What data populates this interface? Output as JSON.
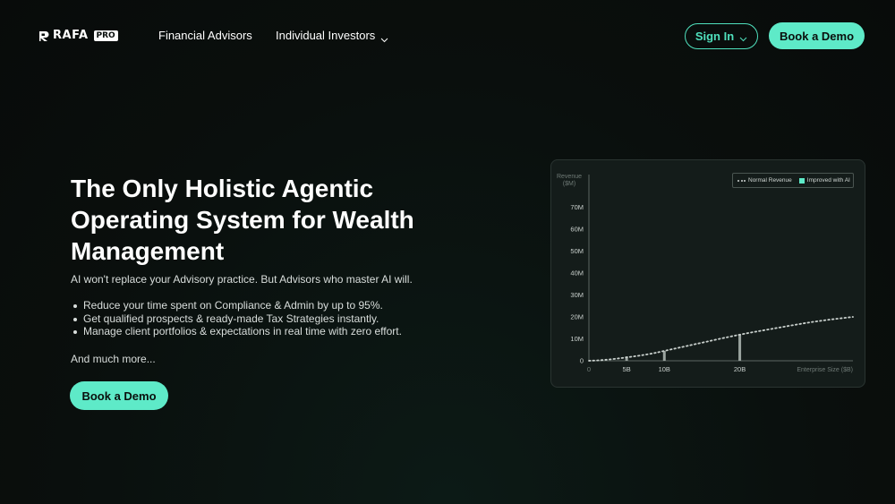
{
  "brand": {
    "name": "RAFA",
    "badge": "PRO",
    "logo_icon": "rafa-logo-icon"
  },
  "nav": {
    "links": [
      {
        "label": "Financial Advisors",
        "has_dropdown": false
      },
      {
        "label": "Individual Investors",
        "has_dropdown": true
      }
    ],
    "sign_in": "Sign In",
    "book_demo": "Book a Demo"
  },
  "hero": {
    "title": "The Only Holistic Agentic Operating System for Wealth Management",
    "subtitle": "AI won't replace your Advisory practice. But Advisors who master AI will.",
    "bullets": [
      "Reduce your time spent on Compliance & Admin by up to 95%.",
      "Get qualified prospects & ready-made Tax Strategies instantly.",
      "Manage client portfolios & expectations in real time with zero effort."
    ],
    "more": "And much more...",
    "cta": "Book a Demo"
  },
  "colors": {
    "accent": "#5eeac8",
    "accent_border": "#4fe0bd",
    "background": "#0a0f0d",
    "card": "#141c1a"
  },
  "chart_data": {
    "type": "line",
    "ylabel": "Revenue ($M)",
    "xlabel": "Enterprise Size ($B)",
    "x_ticks": [
      "0",
      "5B",
      "10B",
      "20B"
    ],
    "x_tick_values": [
      0,
      5,
      10,
      20
    ],
    "y_ticks": [
      "0",
      "10M",
      "20M",
      "30M",
      "40M",
      "50M",
      "60M",
      "70M"
    ],
    "y_tick_values": [
      0,
      10,
      20,
      30,
      40,
      50,
      60,
      70
    ],
    "xlim": [
      0,
      35
    ],
    "ylim": [
      0,
      80
    ],
    "legend": [
      "Normal Revenue",
      "Improved with AI"
    ],
    "legend_position": "top-right",
    "grid": false,
    "series": [
      {
        "name": "Normal Revenue",
        "style": "dotted",
        "x": [
          0,
          2,
          5,
          8,
          10,
          14,
          20,
          25,
          30,
          35
        ],
        "values": [
          0,
          0.3,
          1.5,
          3,
          4.5,
          7.5,
          12,
          15,
          18,
          20
        ]
      },
      {
        "name": "Improved with AI",
        "style": "bars",
        "x": [
          5,
          10,
          20
        ],
        "values": [
          2,
          4.5,
          12
        ]
      }
    ]
  }
}
